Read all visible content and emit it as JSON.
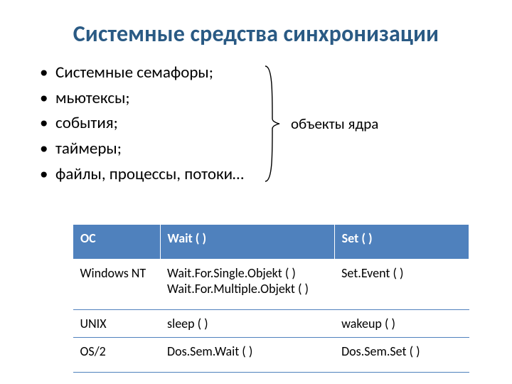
{
  "title": "Системные средства синхронизации",
  "bullets": {
    "items": [
      "Системные семафоры;",
      "мьютексы;",
      "события;",
      "таймеры;",
      "файлы, процессы, потоки…"
    ]
  },
  "annotation": "объекты ядра",
  "table": {
    "headers": {
      "h1": "ОС",
      "h2": "Wait ( )",
      "h3": "Set ( )"
    },
    "rows": [
      {
        "c1": "Windows NT",
        "c2": "Wait.For.Single.Objekt ( )\nWait.For.Multiple.Objekt ( )",
        "c3": "Set.Event ( )"
      },
      {
        "c1": "UNIX",
        "c2": "sleep ( )",
        "c3": "wakeup ( )"
      },
      {
        "c1": "OS/2",
        "c2": "Dos.Sem.Wait ( )",
        "c3": "Dos.Sem.Set ( )"
      }
    ]
  }
}
